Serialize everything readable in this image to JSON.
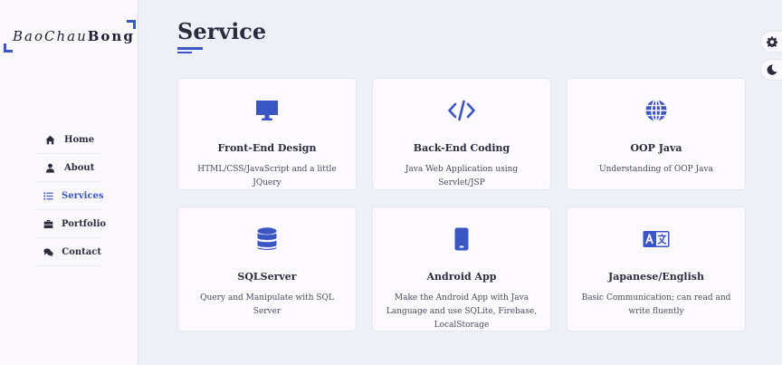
{
  "logo": {
    "part1": "BaoChau",
    "part2": "Bong"
  },
  "nav": {
    "items": [
      {
        "label": "Home",
        "icon": "home-icon",
        "active": false
      },
      {
        "label": "About",
        "icon": "user-icon",
        "active": false
      },
      {
        "label": "Services",
        "icon": "list-icon",
        "active": true
      },
      {
        "label": "Portfolio",
        "icon": "briefcase-icon",
        "active": false
      },
      {
        "label": "Contact",
        "icon": "comments-icon",
        "active": false
      }
    ]
  },
  "page": {
    "title": "Service"
  },
  "services": [
    {
      "icon": "desktop-icon",
      "title": "Front-End Design",
      "desc": "HTML/CSS/JavaScript and a little JQuery"
    },
    {
      "icon": "code-icon",
      "title": "Back-End Coding",
      "desc": "Java Web Application using Servlet/JSP"
    },
    {
      "icon": "globe-icon",
      "title": "OOP Java",
      "desc": "Understanding of OOP Java"
    },
    {
      "icon": "database-icon",
      "title": "SQLServer",
      "desc": "Query and Manipulate with SQL Server"
    },
    {
      "icon": "mobile-icon",
      "title": "Android App",
      "desc": "Make the Android App with Java Language and use SQLite, Firebase, LocalStorage"
    },
    {
      "icon": "language-icon",
      "title": "Japanese/English",
      "desc": "Basic Communication; can read and write fluently"
    }
  ],
  "controls": {
    "settings_icon": "gear-icon",
    "theme_icon": "moon-icon"
  },
  "colors": {
    "accent": "#3a55c4",
    "background": "#eef0f8",
    "sidebar": "#fbf8fc",
    "card": "#fcfaff",
    "text": "#2b2c3e"
  }
}
